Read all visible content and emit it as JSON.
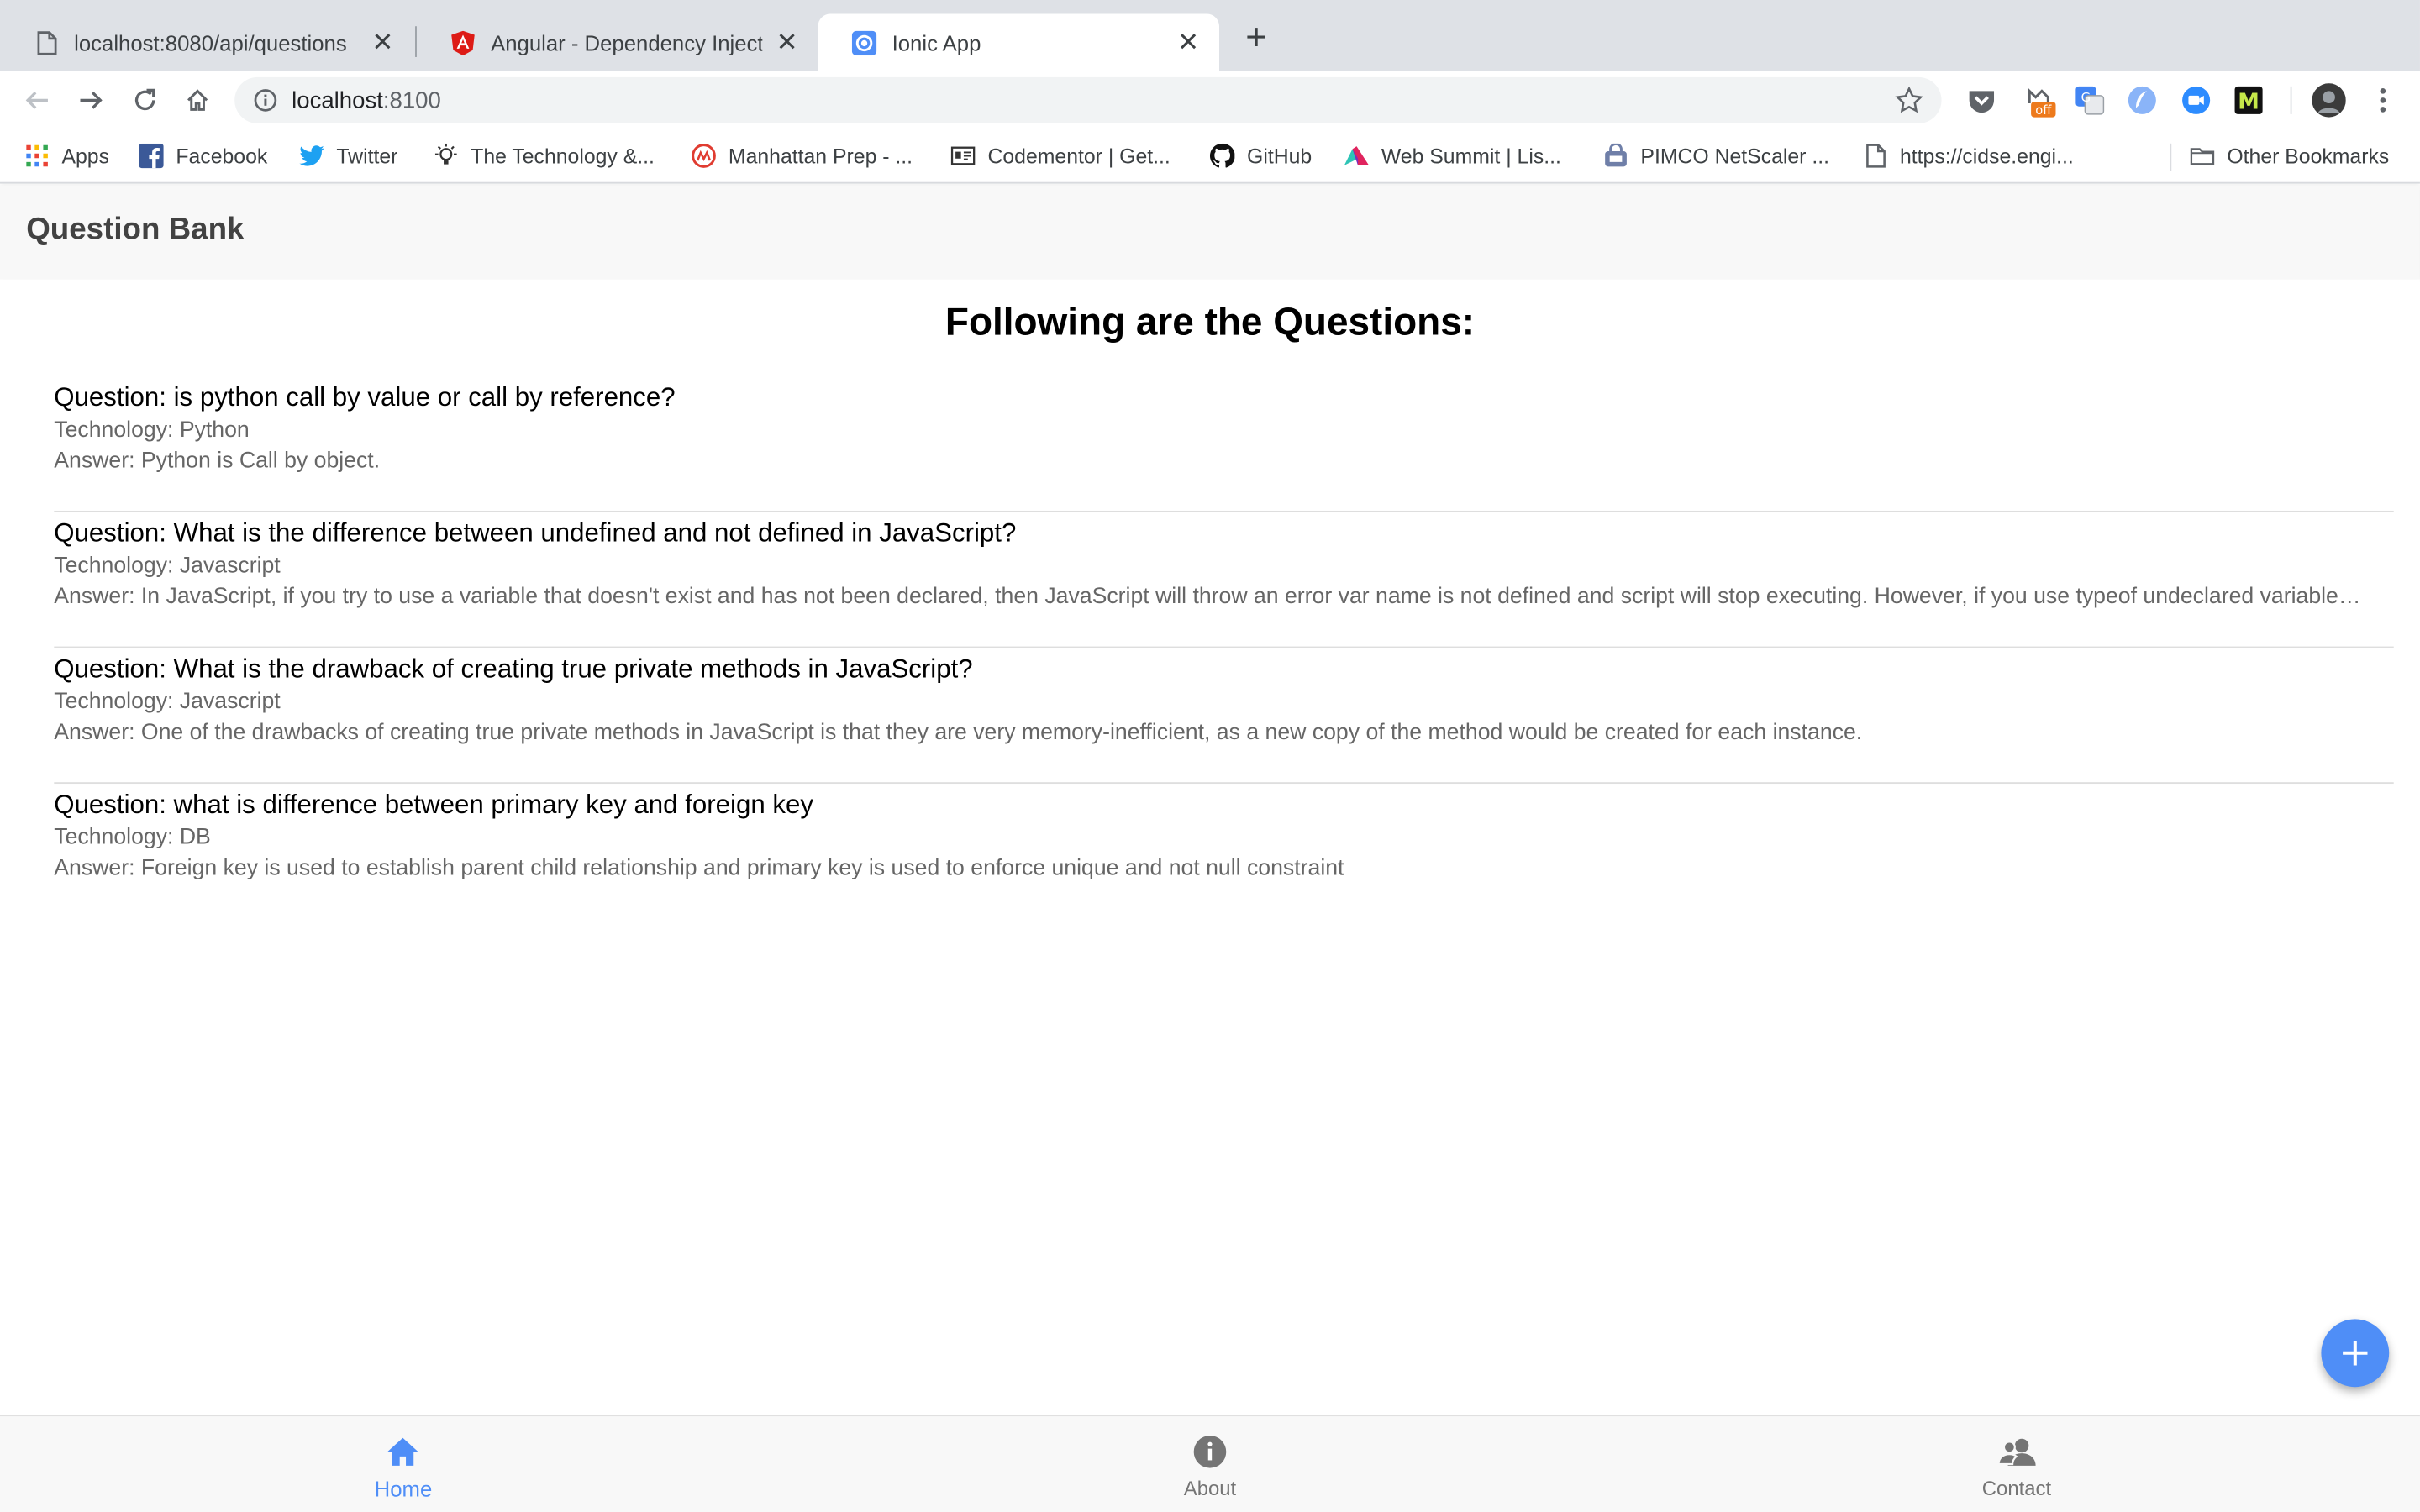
{
  "browser": {
    "tabs": [
      {
        "title": "localhost:8080/api/questions",
        "icon": "document-icon",
        "active": false
      },
      {
        "title": "Angular - Dependency Injection",
        "icon": "angular-icon",
        "active": false
      },
      {
        "title": "Ionic App",
        "icon": "ionic-icon",
        "active": true
      }
    ],
    "url_host": "localhost",
    "url_port": ":8100",
    "bookmarks": [
      {
        "label": "Apps",
        "icon": "apps-grid-icon"
      },
      {
        "label": "Facebook",
        "icon": "facebook-icon"
      },
      {
        "label": "Twitter",
        "icon": "twitter-icon"
      },
      {
        "label": "The Technology &...",
        "icon": "lightbulb-icon"
      },
      {
        "label": "Manhattan Prep - ...",
        "icon": "manhattan-prep-icon"
      },
      {
        "label": "Codementor | Get...",
        "icon": "codementor-icon"
      },
      {
        "label": "GitHub",
        "icon": "github-icon"
      },
      {
        "label": "Web Summit | Lis...",
        "icon": "web-summit-icon"
      },
      {
        "label": "PIMCO NetScaler ...",
        "icon": "lock-icon"
      },
      {
        "label": "https://cidse.engi...",
        "icon": "document-icon"
      }
    ],
    "other_bookmarks": "Other Bookmarks",
    "extension_badge": "off"
  },
  "app": {
    "header_title": "Question Bank",
    "heading": "Following are the Questions:",
    "questions": [
      {
        "question": "Question: is python call by value or call by reference?",
        "technology": "Technology: Python",
        "answer": "Answer: Python is Call by object."
      },
      {
        "question": "Question: What is the difference between undefined and not defined in JavaScript?",
        "technology": "Technology: Javascript",
        "answer": "Answer: In JavaScript, if you try to use a variable that doesn't exist and has not been declared, then JavaScript will throw an error var name is not defined and script will stop executing. However, if you use typeof undeclared variable, then it will return undefined."
      },
      {
        "question": "Question: What is the drawback of creating true private methods in JavaScript?",
        "technology": "Technology: Javascript",
        "answer": "Answer: One of the drawbacks of creating true private methods in JavaScript is that they are very memory-inefficient, as a new copy of the method would be created for each instance."
      },
      {
        "question": "Question: what is difference between primary key and foreign key",
        "technology": "Technology: DB",
        "answer": "Answer: Foreign key is used to establish parent child relationship and primary key is used to enforce unique and not null constraint"
      }
    ],
    "tabbar": [
      {
        "label": "Home",
        "icon": "home-icon",
        "selected": true
      },
      {
        "label": "About",
        "icon": "info-icon",
        "selected": false
      },
      {
        "label": "Contact",
        "icon": "contacts-icon",
        "selected": false
      }
    ],
    "accent_color": "#4f8ef7"
  }
}
